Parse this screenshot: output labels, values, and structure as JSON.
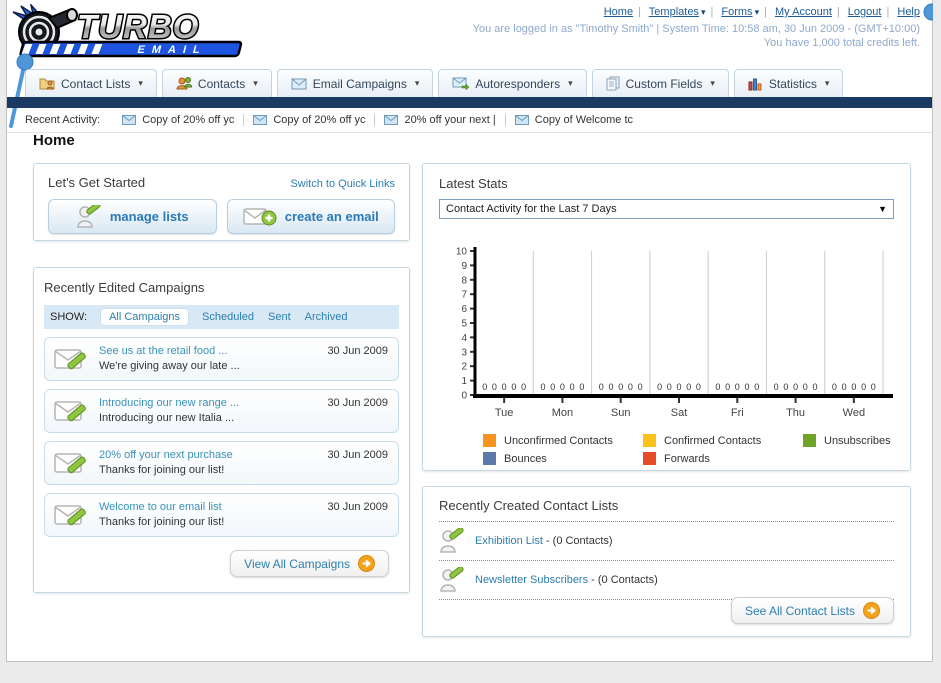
{
  "header": {
    "logo_title": "TURBO",
    "logo_subtitle": "EMAIL",
    "nav": [
      {
        "label": "Home"
      },
      {
        "label": "Templates"
      },
      {
        "label": "Forms"
      },
      {
        "label": "My Account"
      },
      {
        "label": "Logout"
      },
      {
        "label": "Help"
      }
    ],
    "login_info": "You are logged in as \"Timothy Smith\" | System Time: 10:58 am, 30 Jun 2009 - (GMT+10:00)",
    "credits_info": "You have 1,000 total credits left."
  },
  "tabs": [
    {
      "label": "Contact Lists",
      "icon": "contact-lists-icon"
    },
    {
      "label": "Contacts",
      "icon": "contacts-icon"
    },
    {
      "label": "Email Campaigns",
      "icon": "email-campaigns-icon"
    },
    {
      "label": "Autoresponders",
      "icon": "autoresponders-icon"
    },
    {
      "label": "Custom Fields",
      "icon": "custom-fields-icon"
    },
    {
      "label": "Statistics",
      "icon": "statistics-icon"
    }
  ],
  "recent_activity": {
    "label": "Recent Activity:",
    "items": [
      {
        "text": "Copy of 20% off yc"
      },
      {
        "text": "Copy of 20% off yc"
      },
      {
        "text": "20% off your next |"
      },
      {
        "text": "Copy of Welcome tc"
      }
    ]
  },
  "home": {
    "title": "Home"
  },
  "get_started": {
    "title": "Let's Get Started",
    "switch_link": "Switch to Quick Links",
    "manage_lists_label": "manage lists",
    "create_email_label": "create an email"
  },
  "campaigns": {
    "title": "Recently Edited Campaigns",
    "show_label": "SHOW:",
    "filters": [
      {
        "label": "All Campaigns",
        "active": true
      },
      {
        "label": "Scheduled",
        "active": false
      },
      {
        "label": "Sent",
        "active": false
      },
      {
        "label": "Archived",
        "active": false
      }
    ],
    "items": [
      {
        "title": "See us at the retail food ...",
        "subtitle": "We're giving away our late ...",
        "date": "30 Jun 2009"
      },
      {
        "title": "Introducing our new range ...",
        "subtitle": "Introducing our new Italia ...",
        "date": "30 Jun 2009"
      },
      {
        "title": "20% off your next purchase",
        "subtitle": "Thanks for joining our list!",
        "date": "30 Jun 2009"
      },
      {
        "title": "Welcome to our email list",
        "subtitle": "Thanks for joining our list!",
        "date": "30 Jun 2009"
      }
    ],
    "view_all_label": "View All Campaigns"
  },
  "stats": {
    "title": "Latest Stats",
    "selected_option": "Contact Activity for the Last 7 Days"
  },
  "chart_data": {
    "type": "bar",
    "title": "Contact Activity for the Last 7 Days",
    "categories": [
      "Tue",
      "Mon",
      "Sun",
      "Sat",
      "Fri",
      "Thu",
      "Wed"
    ],
    "series": [
      {
        "name": "Unconfirmed Contacts",
        "color": "#f7941e",
        "values": [
          0,
          0,
          0,
          0,
          0,
          0,
          0
        ]
      },
      {
        "name": "Confirmed Contacts",
        "color": "#fcc21c",
        "values": [
          0,
          0,
          0,
          0,
          0,
          0,
          0
        ]
      },
      {
        "name": "Unsubscribes",
        "color": "#6fa526",
        "values": [
          0,
          0,
          0,
          0,
          0,
          0,
          0
        ]
      },
      {
        "name": "Bounces",
        "color": "#5b79ab",
        "values": [
          0,
          0,
          0,
          0,
          0,
          0,
          0
        ]
      },
      {
        "name": "Forwards",
        "color": "#e74c28",
        "values": [
          0,
          0,
          0,
          0,
          0,
          0,
          0
        ]
      }
    ],
    "ylim": [
      0,
      10
    ],
    "ytick_step": 1,
    "grid": true,
    "legend_position": "bottom",
    "xlabel": "",
    "ylabel": ""
  },
  "contact_lists": {
    "title": "Recently Created Contact Lists",
    "items": [
      {
        "name": "Exhibition List",
        "suffix": " - (0 Contacts)"
      },
      {
        "name": "Newsletter Subscribers",
        "suffix": " - (0 Contacts)"
      }
    ],
    "see_all_label": "See All Contact Lists"
  },
  "colors": {
    "navy_bar": "#1b3a63",
    "link": "#2d7fb0",
    "accent_orange": "#f5a31d",
    "pin_blue": "#4e97d9"
  }
}
